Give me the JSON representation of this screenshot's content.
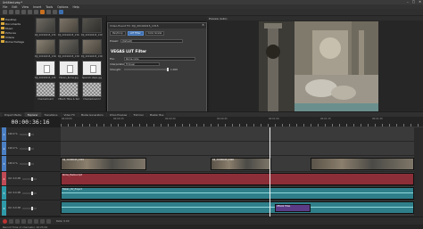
{
  "window": {
    "title": "Untitled.veg *",
    "controls": [
      "–",
      "□",
      "✕"
    ]
  },
  "menu": [
    "File",
    "Edit",
    "View",
    "Insert",
    "Tools",
    "Options",
    "Help"
  ],
  "explorer": {
    "tree": [
      "Desktop",
      "Documents",
      "Music",
      "Pictures",
      "Videos",
      "Rome footage"
    ],
    "thumbnails": [
      {
        "label": "DJI_20190415_1311"
      },
      {
        "label": "DJI_20190415_1312"
      },
      {
        "label": "DJI_20190415_1315"
      },
      {
        "label": "DJI_20190415_1316"
      },
      {
        "label": "DJI_20190415_1318"
      },
      {
        "label": "DJI_20190415_1320"
      },
      {
        "label": "DJI_20190415_1321"
      },
      {
        "label": "Fabian_Rome.jpg"
      },
      {
        "label": "Spanish steps.jpg"
      },
      {
        "label": "Checkerboard"
      },
      {
        "label": "VEGAS Titles & Text"
      },
      {
        "label": "Checkerboard 2"
      }
    ]
  },
  "dialog": {
    "title": "Video Event FX: DJI_20190415_1315",
    "tabs": [
      "Pan/Crop",
      "LUT Filter",
      "Color Grade"
    ],
    "preset_label": "Preset:",
    "preset_value": "(Default)",
    "heading": "VEGAS LUT Filter",
    "file_label": "File:",
    "file_value": "Rome.cube",
    "interp_label": "Interpolation:",
    "interp_value": "Trilinear",
    "strength_label": "Strength:",
    "strength_value": "1.000"
  },
  "preview": {
    "title": "Preview (Auto)",
    "project": "Project: 1920x1080x32, 29.970p",
    "frame": "Frame: 1,095",
    "display": "Display: 480x270x32"
  },
  "tabs": [
    {
      "label": "Project Media",
      "active": false
    },
    {
      "label": "Explorer",
      "active": true
    },
    {
      "label": "Transitions",
      "active": false
    },
    {
      "label": "Video FX",
      "active": false
    },
    {
      "label": "Media Generators",
      "active": false
    },
    {
      "label": "Video Preview",
      "active": false
    },
    {
      "label": "Trimmer",
      "active": false
    },
    {
      "label": "Master Bus",
      "active": false
    }
  ],
  "timeline": {
    "timecode": "00:00:36:16",
    "ruler_labels": [
      "00:00:00",
      "00:00:15",
      "00:00:30",
      "00:00:45",
      "00:01:00",
      "00:01:15",
      "00:01:30"
    ],
    "tracks": [
      {
        "num": "1",
        "level": "100.0 %",
        "color": "#4b7fc3"
      },
      {
        "num": "2",
        "level": "100.0 %",
        "color": "#4b7fc3"
      },
      {
        "num": "3",
        "level": "100.0 %",
        "color": "#4b7fc3"
      },
      {
        "num": "4",
        "level": "Vol: 0.0 dB",
        "color": "#c04a55"
      },
      {
        "num": "5",
        "level": "Vol: 0.0 dB",
        "color": "#2f9aa8"
      },
      {
        "num": "6",
        "level": "Vol: 0.0 dB",
        "color": "#2f9aa8"
      }
    ],
    "clips": [
      {
        "label": "Fabian_Rome.jpg"
      },
      {
        "label": "DJI_20190415_1315"
      },
      {
        "label": "DJI_20190415_1320"
      },
      {
        "label": "Rome_theme.mp3"
      },
      {
        "label": "Fabian_DV_Project"
      },
      {
        "label": "VEGAS Titles"
      }
    ]
  },
  "status": {
    "rate": "Rate: 0.00",
    "record_time": "Record Time (2 channels): 10:23:44"
  }
}
